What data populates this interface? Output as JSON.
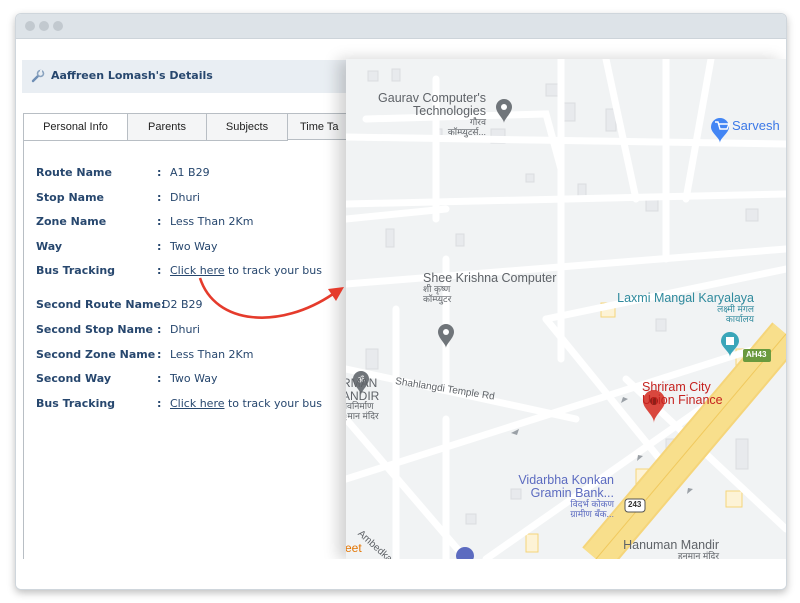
{
  "window": {
    "controls": [
      "close",
      "minimize",
      "maximize"
    ]
  },
  "details": {
    "title": "Aaffreen Lomash's Details",
    "icon": "wrench-icon"
  },
  "tabs": [
    {
      "label": "Personal Info",
      "active": true
    },
    {
      "label": "Parents",
      "active": false
    },
    {
      "label": "Subjects",
      "active": false
    },
    {
      "label": "Time Ta",
      "active": false
    }
  ],
  "primary_route": {
    "route_name": {
      "label": "Route Name",
      "value": "A1 B29"
    },
    "stop_name": {
      "label": "Stop Name",
      "value": "Dhuri"
    },
    "zone_name": {
      "label": "Zone Name",
      "value": "Less Than 2Km"
    },
    "way": {
      "label": "Way",
      "value": "Two Way"
    },
    "bus_tracking": {
      "label": "Bus Tracking",
      "link": "Click here",
      "suffix": " to track your bus"
    }
  },
  "second_route": {
    "route_name": {
      "label": "Second Route Name:",
      "value": "D2 B29"
    },
    "stop_name": {
      "label": "Second Stop Name",
      "value": "Dhuri"
    },
    "zone_name": {
      "label": "Second Zone Name",
      "value": "Less Than 2Km"
    },
    "way": {
      "label": "Second Way",
      "value": "Two Way"
    },
    "bus_tracking": {
      "label": "Bus Tracking",
      "link": "Click here",
      "suffix": " to track your bus"
    }
  },
  "colon": ":",
  "annotation": {
    "arrow_color": "#e53b2c"
  },
  "map": {
    "places": {
      "gaurav": {
        "line1": "Gaurav Computer's",
        "line2": "Technologies",
        "hindi1": "गौरव",
        "hindi2": "कॉम्प्युटर्स..."
      },
      "sarvesh": {
        "name": "Sarvesh"
      },
      "shee": {
        "line1": "Shee Krishna Computer",
        "hindi1": "शी कृष्ण",
        "hindi2": "कॉम्प्युटर"
      },
      "laxmi": {
        "line1": "Laxmi Mangal Karyalaya",
        "hindi1": "लक्ष्मी मंगल",
        "hindi2": "कार्यालय"
      },
      "shriram": {
        "line1": "Shriram City",
        "line2": "Union Finance"
      },
      "rman": {
        "line1": "RMAN",
        "line2": "ANDIR",
        "hindi1": "नवनिर्माण",
        "hindi2": "ुमान मंदिर"
      },
      "vidarbha": {
        "line1": "Vidarbha Konkan",
        "line2": "Gramin Bank...",
        "hindi1": "विदर्भ कोकण",
        "hindi2": "ग्रामीण बँक..."
      },
      "hanuman": {
        "line1": "Hanuman Mandir",
        "hindi1": "हनुमान मंदिर"
      },
      "eet": {
        "line1": "eet"
      }
    },
    "roads": {
      "shahlangdi": "Shahlangdi Temple Rd",
      "ambedkar": "Ambedkar"
    },
    "shields": {
      "ah43": "AH43",
      "nh243": "243"
    },
    "colors": {
      "background": "#f1f3f4",
      "road": "#ffffff",
      "highway": "#f8df8c",
      "poi_gray": "#70757a",
      "poi_blue": "#4285f4",
      "poi_teal": "#3aa6b9",
      "poi_red": "#d9473e",
      "poi_bank": "#5c6bc0"
    }
  }
}
